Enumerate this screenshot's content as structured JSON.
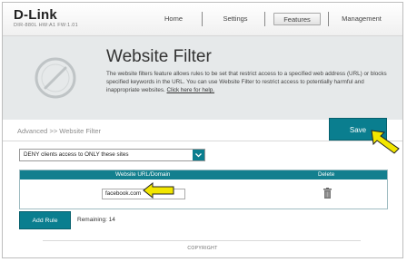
{
  "brand": {
    "logo": "D-Link",
    "model_line": "DIR-880L   HW:A1   FW:1.01"
  },
  "nav": {
    "home": "Home",
    "settings": "Settings",
    "features": "Features",
    "management": "Management",
    "active": "Features"
  },
  "banner": {
    "icon": "no-symbol-icon",
    "title": "Website Filter",
    "description": "The website filters feature allows rules to be set that restrict access to a specified web address (URL) or blocks specified keywords in the URL. You can use Website Filter to restrict access to potentially harmful and inappropriate websites.",
    "help_link": "Click here for help."
  },
  "breadcrumb": "Advanced >> Website Filter",
  "save_label": "Save",
  "filter_mode": {
    "selected": "DENY clients access to ONLY these sites"
  },
  "table": {
    "headers": {
      "url": "Website URL/Domain",
      "delete": "Delete"
    },
    "rows": [
      {
        "url": "facebook.com",
        "delete_icon": "trash-icon"
      }
    ]
  },
  "add_rule_label": "Add Rule",
  "remaining": "Remaining: 14",
  "footer": {
    "copyright": "COPYRIGHT"
  },
  "colors": {
    "accent": "#0a7e8f",
    "annotation_arrow": "#f2e600"
  }
}
